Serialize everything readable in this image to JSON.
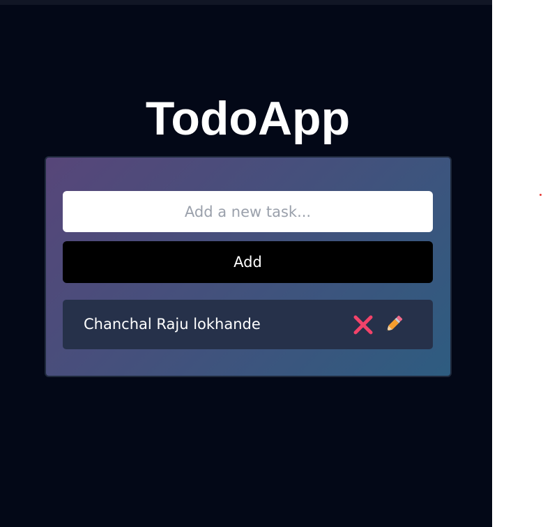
{
  "app": {
    "title": "TodoApp"
  },
  "form": {
    "input_placeholder": "Add a new task...",
    "input_value": "",
    "add_label": "Add"
  },
  "todos": [
    {
      "text": "Chanchal Raju lokhande",
      "delete_icon": "cross-mark-icon",
      "edit_icon": "pencil-icon"
    }
  ],
  "colors": {
    "background": "#030817",
    "card_gradient_start": "#574679",
    "card_gradient_end": "#2e5c80",
    "button": "#000000",
    "todo_item": "#26314a",
    "delete_icon": "#f2436a",
    "edit_icon": "#f59e2e"
  }
}
